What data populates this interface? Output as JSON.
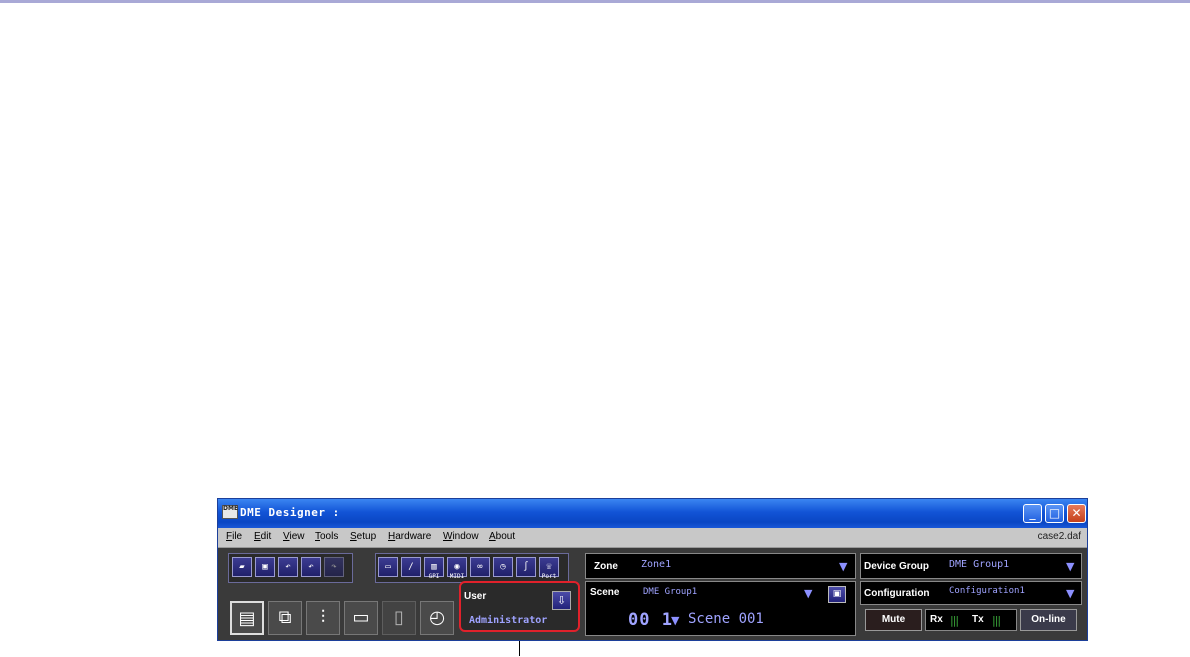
{
  "window": {
    "title": "DME Designer :",
    "app_icon_text": "DME",
    "file_name": "case2.daf",
    "minimize": "_",
    "maximize": "□",
    "close": "✕"
  },
  "menu": [
    "File",
    "Edit",
    "View",
    "Tools",
    "Setup",
    "Hardware",
    "Window",
    "About"
  ],
  "toolbar": {
    "gpi": "GPI",
    "midi": "MIDI",
    "port": "Port"
  },
  "zone": {
    "label": "Zone",
    "value": "Zone1"
  },
  "scene": {
    "label": "Scene",
    "group": "DME Group1",
    "number": "00 1",
    "name": "Scene 001"
  },
  "device_group": {
    "label": "Device Group",
    "value": "DME Group1"
  },
  "configuration": {
    "label": "Configuration",
    "value": "Configuration1"
  },
  "user": {
    "label": "User",
    "name": "Administrator"
  },
  "mute": "Mute",
  "rx": "Rx",
  "tx": "Tx",
  "online": "On-line",
  "arrow": "▼",
  "colors": {
    "accent": "#9fa3ff",
    "highlight": "#e0212b",
    "titlebar": "#0a46c4"
  }
}
